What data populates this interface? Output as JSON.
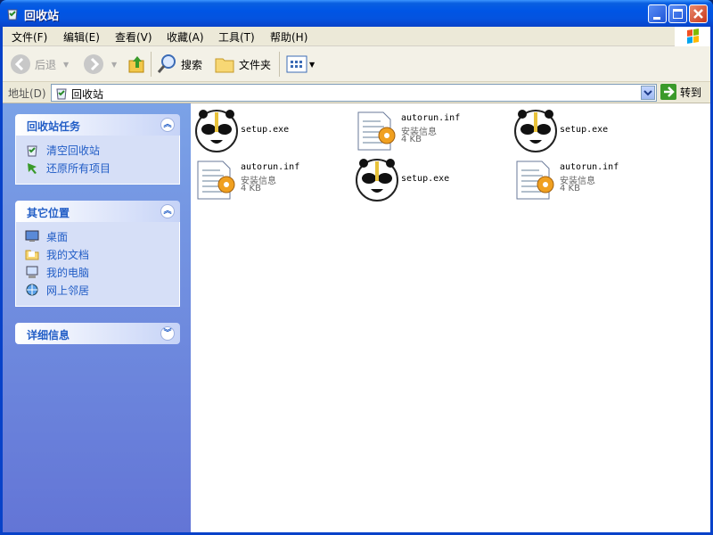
{
  "window": {
    "title": "回收站"
  },
  "menubar": {
    "items": [
      "文件(F)",
      "编辑(E)",
      "查看(V)",
      "收藏(A)",
      "工具(T)",
      "帮助(H)"
    ]
  },
  "toolbar": {
    "back_label": "后退",
    "search_label": "搜索",
    "folders_label": "文件夹"
  },
  "address": {
    "label": "地址(D)",
    "value": "回收站",
    "go_label": "转到"
  },
  "sidebar": {
    "tasks": {
      "title": "回收站任务",
      "items": [
        "清空回收站",
        "还原所有项目"
      ]
    },
    "places": {
      "title": "其它位置",
      "items": [
        "桌面",
        "我的文档",
        "我的电脑",
        "网上邻居"
      ]
    },
    "details": {
      "title": "详细信息"
    }
  },
  "files": [
    {
      "name": "setup.exe",
      "type": "",
      "size": "",
      "kind": "panda"
    },
    {
      "name": "autorun.inf",
      "type": "安装信息",
      "size": "4 KB",
      "kind": "inf"
    },
    {
      "name": "setup.exe",
      "type": "",
      "size": "",
      "kind": "panda"
    },
    {
      "name": "autorun.inf",
      "type": "安装信息",
      "size": "4 KB",
      "kind": "inf"
    },
    {
      "name": "setup.exe",
      "type": "",
      "size": "",
      "kind": "panda"
    },
    {
      "name": "autorun.inf",
      "type": "安装信息",
      "size": "4 KB",
      "kind": "inf"
    }
  ],
  "colors": {
    "titlebar": "#0055e5",
    "sidebar_link": "#215dc6",
    "sidebar_bg": "#7ba2e7"
  }
}
